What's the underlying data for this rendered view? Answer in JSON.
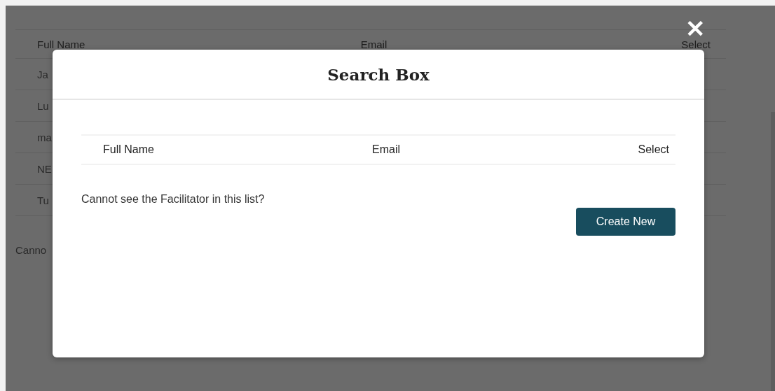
{
  "background_table": {
    "columns": [
      "Full Name",
      "Email",
      "Select"
    ],
    "rows": [
      "Ja",
      "Lu",
      "ma",
      "NE",
      "Tu"
    ]
  },
  "background_note": "Canno",
  "close": {
    "label": "✕"
  },
  "modal": {
    "title": "Search Box",
    "table": {
      "columns": [
        "Full Name",
        "Email",
        "Select"
      ]
    },
    "note": "Cannot see the Facilitator in this list?",
    "button": "Create New"
  }
}
